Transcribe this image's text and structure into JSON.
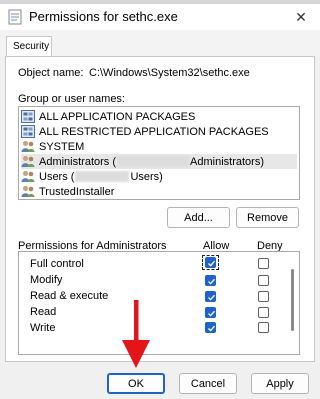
{
  "window": {
    "title": "Permissions for sethc.exe",
    "close_glyph": "✕"
  },
  "tabs": [
    {
      "label": "Security"
    }
  ],
  "object": {
    "label": "Object name:",
    "value": "C:\\Windows\\System32\\sethc.exe"
  },
  "groups": {
    "label": "Group or user names:",
    "items": [
      {
        "icon": "package-group-icon",
        "label": "ALL APPLICATION PACKAGES"
      },
      {
        "icon": "package-group-icon",
        "label": "ALL RESTRICTED APPLICATION PACKAGES"
      },
      {
        "icon": "users-icon",
        "label": "SYSTEM"
      },
      {
        "icon": "users-icon",
        "label_before": "Administrators (",
        "label_after": "Administrators)",
        "selected": true
      },
      {
        "icon": "users-icon",
        "label_before": "Users (",
        "label_after": "Users)"
      },
      {
        "icon": "users-icon",
        "label": "TrustedInstaller"
      }
    ],
    "add_label": "Add...",
    "remove_label": "Remove"
  },
  "permissions": {
    "label": "Permissions for Administrators",
    "allow_header": "Allow",
    "deny_header": "Deny",
    "rows": [
      {
        "name": "Full control",
        "allow": true,
        "deny": false
      },
      {
        "name": "Modify",
        "allow": true,
        "deny": false
      },
      {
        "name": "Read & execute",
        "allow": true,
        "deny": false
      },
      {
        "name": "Read",
        "allow": true,
        "deny": false
      },
      {
        "name": "Write",
        "allow": true,
        "deny": false
      }
    ]
  },
  "footer": {
    "ok_label": "OK",
    "cancel_label": "Cancel",
    "apply_label": "Apply"
  },
  "colors": {
    "accent": "#1e63c6",
    "arrow": "#e4141b"
  }
}
